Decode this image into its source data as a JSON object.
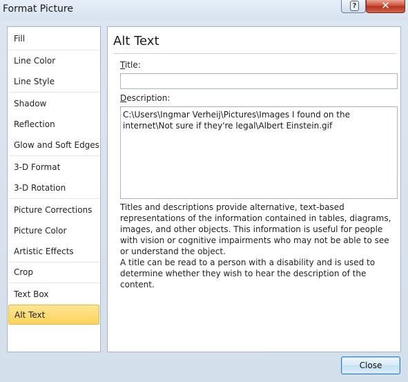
{
  "window": {
    "title": "Format Picture",
    "help_symbol": "?",
    "close_symbol": "✕"
  },
  "sidebar": {
    "items": [
      {
        "label": "Fill"
      },
      {
        "label": "Line Color"
      },
      {
        "label": "Line Style"
      },
      {
        "label": "Shadow"
      },
      {
        "label": "Reflection"
      },
      {
        "label": "Glow and Soft Edges"
      },
      {
        "label": "3-D Format"
      },
      {
        "label": "3-D Rotation"
      },
      {
        "label": "Picture Corrections"
      },
      {
        "label": "Picture Color"
      },
      {
        "label": "Artistic Effects"
      },
      {
        "label": "Crop"
      },
      {
        "label": "Text Box"
      },
      {
        "label": "Alt Text"
      }
    ],
    "selected": "Alt Text"
  },
  "main": {
    "heading": "Alt Text",
    "title_label_key": "T",
    "title_label_rest": "itle:",
    "title_value": "",
    "description_label_key": "D",
    "description_label_rest": "escription:",
    "description_value": "C:\\Users\\Ingmar Verheij\\Pictures\\Images I found on the internet\\Not sure if they're legal\\Albert Einstein.gif",
    "help_paragraph_1": "Titles and descriptions provide alternative, text-based representations of the information contained in tables, diagrams, images, and other objects. This information is useful for people with vision or cognitive impairments who may not be able to see or understand the object.",
    "help_paragraph_2": "A title can be read to a person with a disability and is used to determine whether they wish to hear the description of the content."
  },
  "footer": {
    "close_label": "Close"
  },
  "colors": {
    "selected_item": "#fcd35e",
    "window_bg": "#dce6f2",
    "close_caption": "#c7462c"
  }
}
